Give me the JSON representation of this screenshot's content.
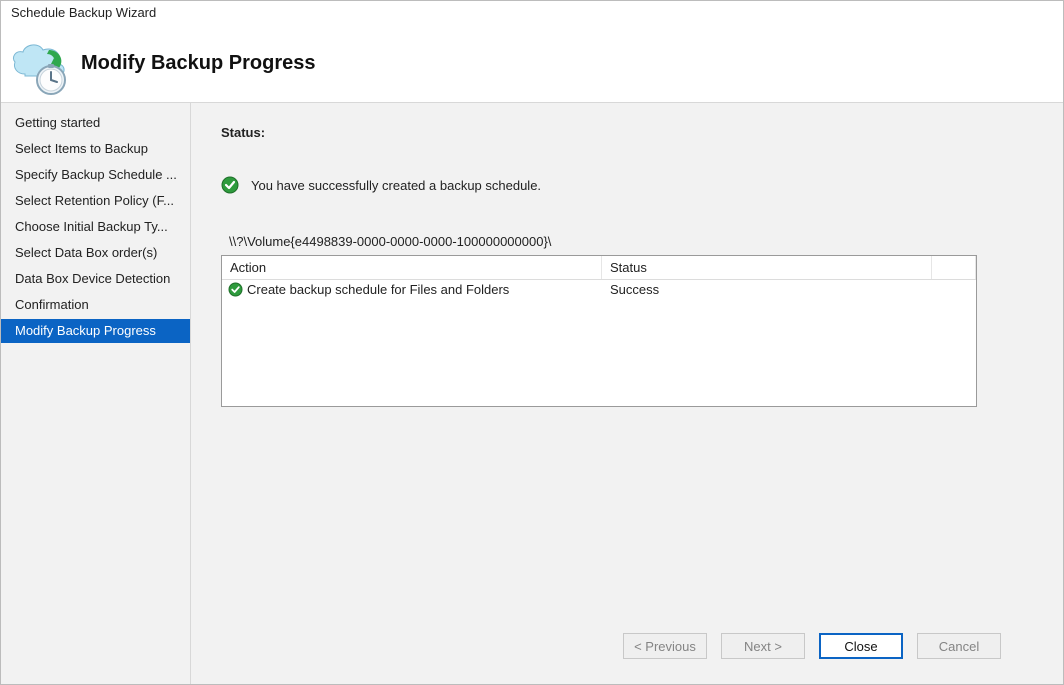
{
  "window_title": "Schedule Backup Wizard",
  "page_title": "Modify Backup Progress",
  "sidebar": {
    "items": [
      {
        "label": "Getting started"
      },
      {
        "label": "Select Items to Backup"
      },
      {
        "label": "Specify Backup Schedule ..."
      },
      {
        "label": "Select Retention Policy (F..."
      },
      {
        "label": "Choose Initial Backup Ty..."
      },
      {
        "label": "Select Data Box order(s)"
      },
      {
        "label": "Data Box Device Detection"
      },
      {
        "label": "Confirmation"
      },
      {
        "label": "Modify Backup Progress"
      }
    ],
    "selected_index": 8
  },
  "main": {
    "status_label": "Status:",
    "success_message": "You have successfully created a backup schedule.",
    "volume_path": "\\\\?\\Volume{e4498839-0000-0000-0000-100000000000}\\",
    "table": {
      "headers": {
        "action": "Action",
        "status": "Status"
      },
      "rows": [
        {
          "action": "Create backup schedule for Files and Folders",
          "status": "Success"
        }
      ]
    }
  },
  "footer": {
    "previous": "< Previous",
    "next": "Next >",
    "close": "Close",
    "cancel": "Cancel"
  }
}
